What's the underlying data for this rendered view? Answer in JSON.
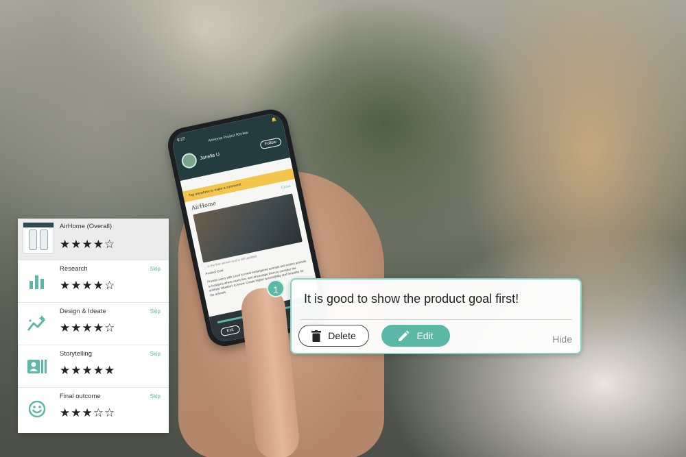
{
  "phone": {
    "time": "9:27",
    "header_title": "AirHome Project Review",
    "user_name": "Janelle U",
    "follow_label": "Follow",
    "banner_text": "Tap anywhere to make a comment!",
    "section_title": "AirHome",
    "section_close": "Close",
    "caption": "... is the first version and is still updated",
    "body_heading": "Product Goal",
    "body_text": "Provide users with a tool to meet endangered animals and extinct animals in locations where users live, and encourage them to consider the animals' situation; to know. Create higher accessibility and empathy for the animals.",
    "badge_number": "1",
    "exit_label": "Exit"
  },
  "ratings": [
    {
      "name": "AirHome (Overall)",
      "stars": "★★★★☆",
      "icon": "project-thumbnail",
      "skip": ""
    },
    {
      "name": "Research",
      "stars": "★★★★☆",
      "icon": "bar-chart-icon",
      "skip": "Skip"
    },
    {
      "name": "Design & Ideate",
      "stars": "★★★★☆",
      "icon": "sparkle-trend-icon",
      "skip": "Skip"
    },
    {
      "name": "Storytelling",
      "stars": "★★★★★",
      "icon": "storyboard-icon",
      "skip": "Skip"
    },
    {
      "name": "Final outcome",
      "stars": "★★★☆☆",
      "icon": "smiley-icon",
      "skip": "Skip"
    }
  ],
  "comment": {
    "pin_number": "1",
    "text": "It is good to show the product goal first!",
    "delete_label": "Delete",
    "edit_label": "Edit",
    "hide_label": "Hide"
  },
  "colors": {
    "accent": "#5cb8a6",
    "comment_border": "#84d2c4",
    "banner": "#f2c64a",
    "phone_header": "#243b3f"
  }
}
